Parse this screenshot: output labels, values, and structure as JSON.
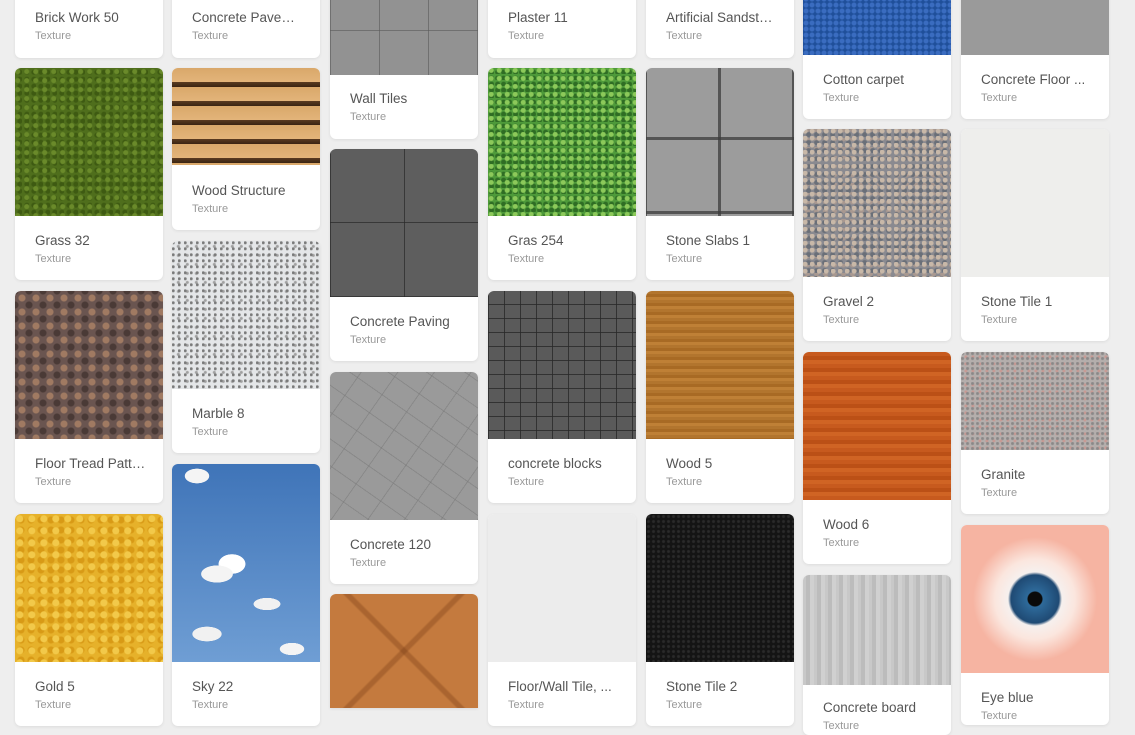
{
  "cards": [
    {
      "title": "Brick Work 50",
      "subtitle": "Texture"
    },
    {
      "title": "Concrete Pavement",
      "subtitle": "Texture"
    },
    {
      "title": "Wall Tiles",
      "subtitle": "Texture"
    },
    {
      "title": "Plaster 11",
      "subtitle": "Texture"
    },
    {
      "title": "Artificial Sandstone",
      "subtitle": "Texture"
    },
    {
      "title": "Cotton carpet",
      "subtitle": "Texture"
    },
    {
      "title": "Concrete Floor ...",
      "subtitle": "Texture"
    },
    {
      "title": "Grass 32",
      "subtitle": "Texture"
    },
    {
      "title": "Wood Structure",
      "subtitle": "Texture"
    },
    {
      "title": "Concrete Paving",
      "subtitle": "Texture"
    },
    {
      "title": "Gras 254",
      "subtitle": "Texture"
    },
    {
      "title": "Stone Slabs 1",
      "subtitle": "Texture"
    },
    {
      "title": "Gravel 2",
      "subtitle": "Texture"
    },
    {
      "title": "Stone Tile 1",
      "subtitle": "Texture"
    },
    {
      "title": "Floor Tread Pattern",
      "subtitle": "Texture"
    },
    {
      "title": "Marble 8",
      "subtitle": "Texture"
    },
    {
      "title": "Concrete 120",
      "subtitle": "Texture"
    },
    {
      "title": "concrete blocks",
      "subtitle": "Texture"
    },
    {
      "title": "Wood 5",
      "subtitle": "Texture"
    },
    {
      "title": "Granite",
      "subtitle": "Texture"
    },
    {
      "title": "Wood 6",
      "subtitle": "Texture"
    },
    {
      "title": "Gold 5",
      "subtitle": "Texture"
    },
    {
      "title": "Sky 22",
      "subtitle": "Texture"
    },
    {
      "title": "Floor/Wall Tile, ...",
      "subtitle": "Texture"
    },
    {
      "title": "Stone Tile 2",
      "subtitle": "Texture"
    },
    {
      "title": "Concrete board",
      "subtitle": "Texture"
    },
    {
      "title": "Eye blue",
      "subtitle": "Texture"
    }
  ]
}
